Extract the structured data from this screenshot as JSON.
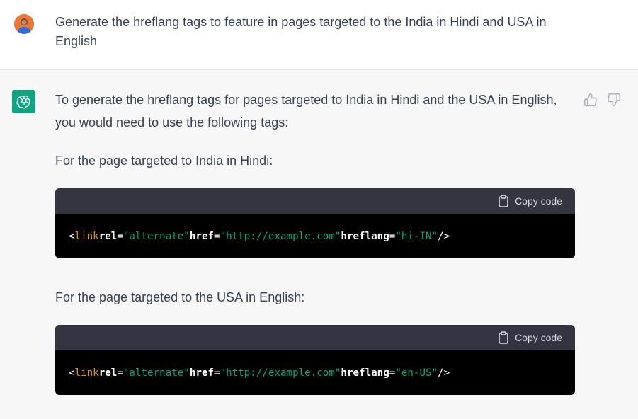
{
  "user": {
    "avatar": "user-avatar",
    "message": "Generate the hreflang tags to feature in pages targeted to the India in Hindi and USA in English"
  },
  "assistant": {
    "avatar_icon": "openai-logo-icon",
    "intro": "To generate the hreflang tags for pages targeted to India in Hindi and the USA in English, you would need to use the following tags:",
    "india_heading": "For the page targeted to India in Hindi:",
    "usa_heading": "For the page targeted to the USA in English:",
    "feedback": {
      "thumbs_up_icon": "thumbs-up-icon",
      "thumbs_down_icon": "thumbs-down-icon"
    },
    "code_blocks": [
      {
        "copy_label": "Copy code",
        "tokens": {
          "open": "<",
          "tag": "link",
          "rel_attr": "rel",
          "eq1": "=",
          "rel_value": "\"alternate\"",
          "href_attr": "href",
          "eq2": "=",
          "href_value": "\"http://example.com\"",
          "hreflang_attr": "hreflang",
          "eq3": "=",
          "hreflang_value": "\"hi-IN\"",
          "close": "/>"
        }
      },
      {
        "copy_label": "Copy code",
        "tokens": {
          "open": "<",
          "tag": "link",
          "rel_attr": "rel",
          "eq1": "=",
          "rel_value": "\"alternate\"",
          "href_attr": "href",
          "eq2": "=",
          "href_value": "\"http://example.com\"",
          "hreflang_attr": "hreflang",
          "eq3": "=",
          "hreflang_value": "\"en-US\"",
          "close": "/>"
        }
      }
    ]
  },
  "colors": {
    "accent": "#10a37f",
    "code_header": "#343541",
    "code_bg": "#000000",
    "tag": "#e9950c",
    "string": "#00a67d"
  }
}
